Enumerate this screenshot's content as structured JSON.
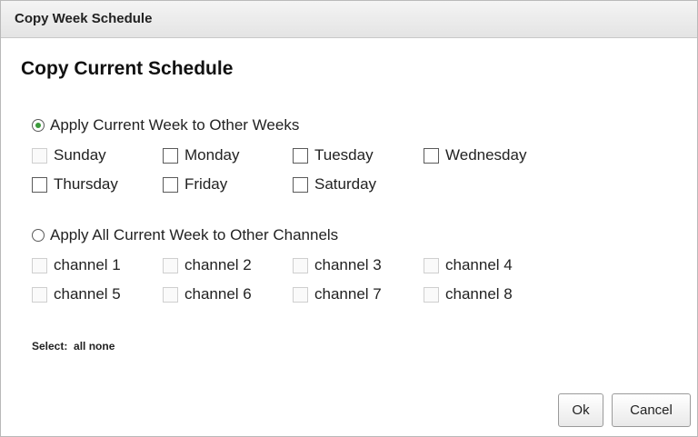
{
  "window": {
    "title": "Copy Week Schedule"
  },
  "heading": "Copy Current Schedule",
  "weeks_option": {
    "label": "Apply Current Week to Other Weeks",
    "selected": true,
    "days": [
      {
        "label": "Sunday",
        "checked": false,
        "disabled": true
      },
      {
        "label": "Monday",
        "checked": false,
        "disabled": false
      },
      {
        "label": "Tuesday",
        "checked": false,
        "disabled": false
      },
      {
        "label": "Wednesday",
        "checked": false,
        "disabled": false
      },
      {
        "label": "Thursday",
        "checked": false,
        "disabled": false
      },
      {
        "label": "Friday",
        "checked": false,
        "disabled": false
      },
      {
        "label": "Saturday",
        "checked": false,
        "disabled": false
      }
    ]
  },
  "channels_option": {
    "label": "Apply All Current Week to Other Channels",
    "selected": false,
    "channels": [
      {
        "label": "channel 1",
        "checked": false,
        "disabled": true
      },
      {
        "label": "channel 2",
        "checked": false,
        "disabled": true
      },
      {
        "label": "channel 3",
        "checked": false,
        "disabled": true
      },
      {
        "label": "channel 4",
        "checked": false,
        "disabled": true
      },
      {
        "label": "channel 5",
        "checked": false,
        "disabled": true
      },
      {
        "label": "channel 6",
        "checked": false,
        "disabled": true
      },
      {
        "label": "channel 7",
        "checked": false,
        "disabled": true
      },
      {
        "label": "channel 8",
        "checked": false,
        "disabled": true
      }
    ]
  },
  "select": {
    "label": "Select:",
    "all": "all",
    "none": "none"
  },
  "buttons": {
    "ok": "Ok",
    "cancel": "Cancel"
  },
  "colors": {
    "radio_selected": "#3a9a3a"
  }
}
